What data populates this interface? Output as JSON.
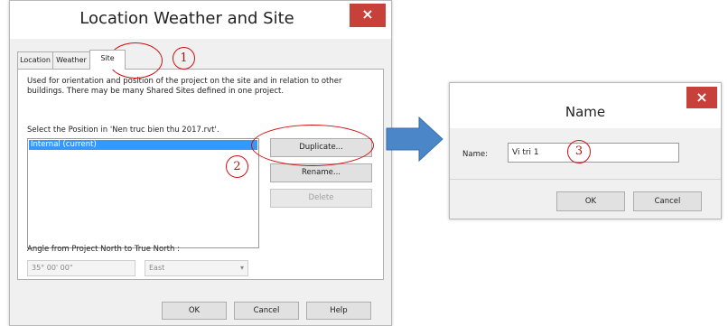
{
  "dialog_location": {
    "title": "Location Weather and Site",
    "close_glyph": "×",
    "tabs": [
      {
        "label": "Location"
      },
      {
        "label": "Weather"
      },
      {
        "label": "Site"
      }
    ],
    "description": "Used for orientation and position of the project on the site and in relation to other buildings. There may be many Shared Sites defined in one project.",
    "select_label": "Select the Position in 'Nen truc bien thu 2017.rvt'.",
    "positions": [
      "Internal (current)"
    ],
    "buttons": {
      "duplicate": "Duplicate...",
      "rename": "Rename...",
      "delete": "Delete",
      "ok": "OK",
      "cancel": "Cancel",
      "help": "Help"
    },
    "angle_label": "Angle from Project North to True North :",
    "angle_value": "35° 00' 00\"",
    "direction_value": "East"
  },
  "callouts": [
    "1",
    "2",
    "3"
  ],
  "dialog_name": {
    "title": "Name",
    "close_glyph": "×",
    "name_label": "Name:",
    "name_value": "Vi tri 1",
    "ok": "OK",
    "cancel": "Cancel"
  },
  "colors": {
    "close_button": "#c7403a",
    "selection": "#3399ff",
    "callout": "#d01010",
    "arrow": "#4a86c8"
  },
  "icons": [
    "close-icon",
    "dropdown-arrow-icon",
    "right-arrow"
  ]
}
